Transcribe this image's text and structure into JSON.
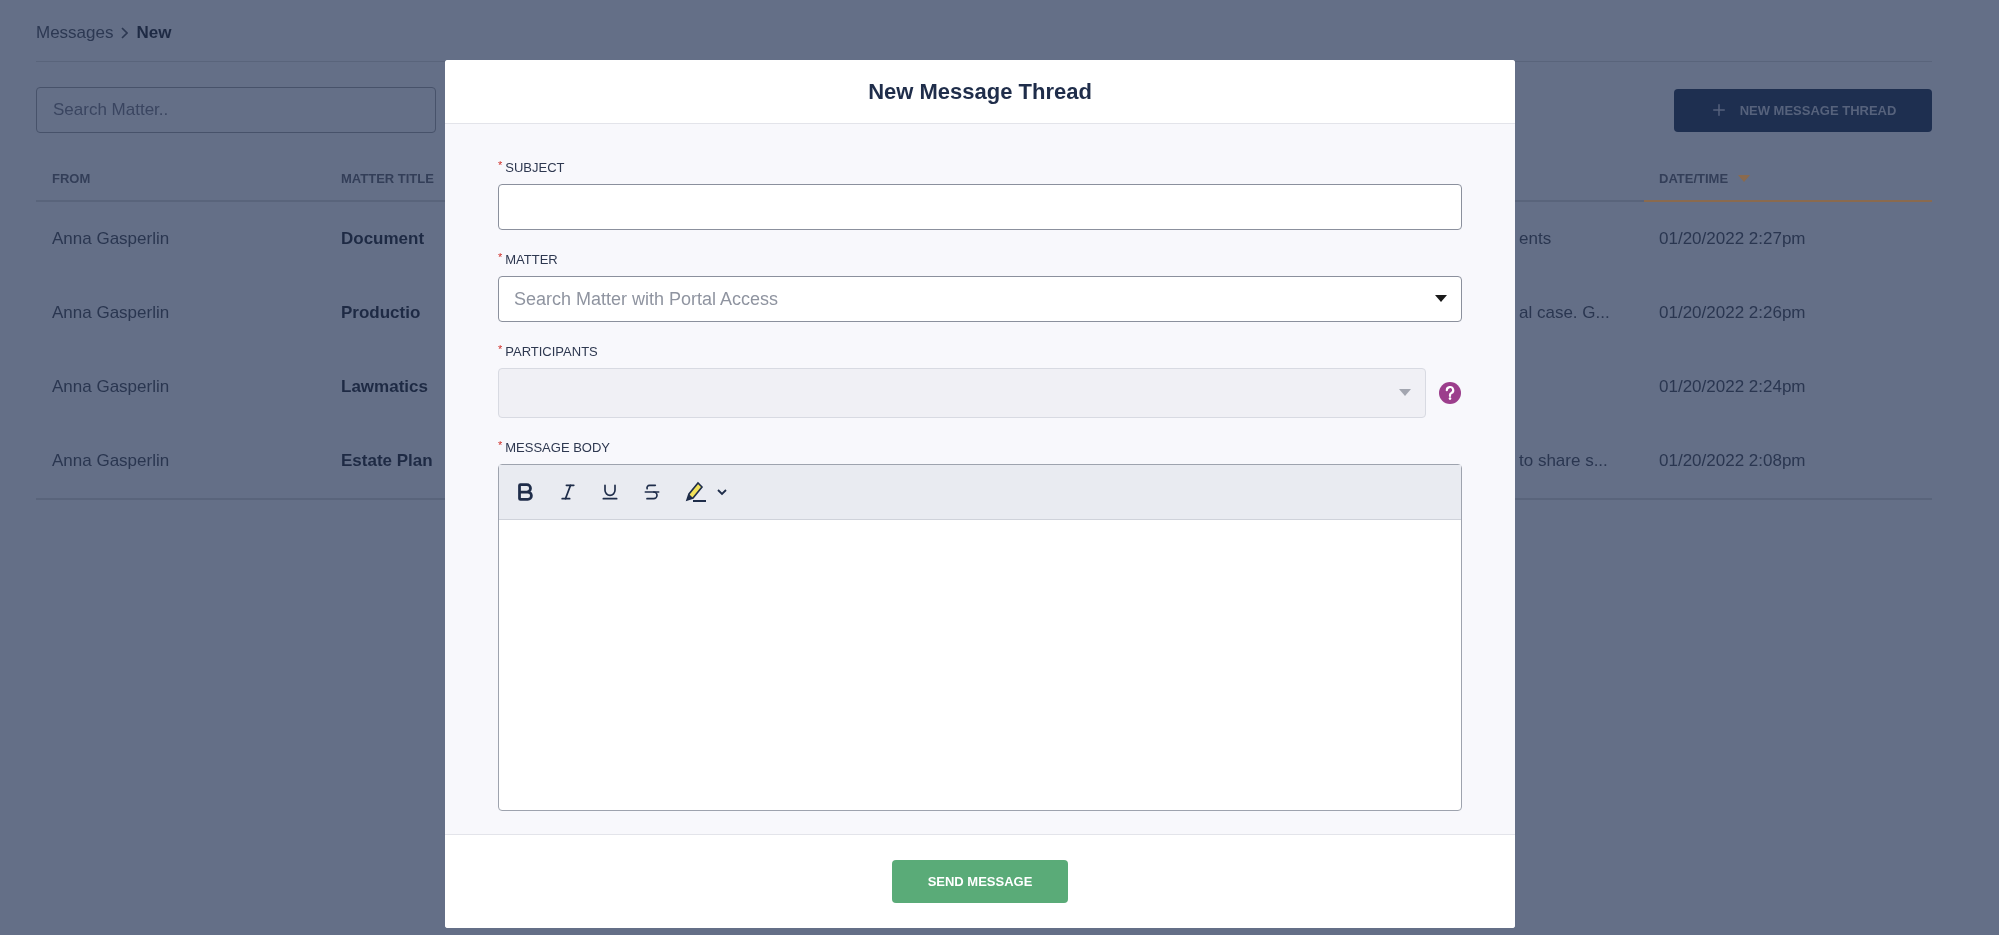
{
  "breadcrumb": {
    "items": [
      {
        "label": "Messages",
        "current": false
      },
      {
        "label": "New",
        "current": true
      }
    ]
  },
  "search": {
    "placeholder": "Search Matter.."
  },
  "new_thread_button": {
    "label": "NEW MESSAGE THREAD"
  },
  "table": {
    "columns": [
      {
        "label": "FROM",
        "sorted": false
      },
      {
        "label": "MATTER TITLE",
        "sorted": false
      },
      {
        "label": "DATE/TIME",
        "sorted": true
      }
    ],
    "rows": [
      {
        "from": "Anna Gasperlin",
        "matter_title": "Document",
        "column_3": "ents",
        "date_time": "01/20/2022 2:27pm"
      },
      {
        "from": "Anna Gasperlin",
        "matter_title": "Productio",
        "column_3": "al case. G...",
        "date_time": "01/20/2022 2:26pm"
      },
      {
        "from": "Anna Gasperlin",
        "matter_title": "Lawmatics",
        "date_time": "01/20/2022 2:24pm"
      },
      {
        "from": "Anna Gasperlin",
        "matter_title": "Estate Plan",
        "column_3": "to share s...",
        "date_time": "01/20/2022 2:08pm"
      }
    ]
  },
  "modal": {
    "title": "New Message Thread",
    "fields": [
      {
        "kind": "text",
        "label": "SUBJECT",
        "required_mark": "*"
      },
      {
        "kind": "select",
        "label": "MATTER",
        "required_mark": "*",
        "placeholder": "Search Matter with Portal Access",
        "disabled": false
      },
      {
        "kind": "select",
        "label": "PARTICIPANTS",
        "required_mark": "*",
        "disabled": true,
        "help": true
      },
      {
        "kind": "editor",
        "label": "MESSAGE BODY",
        "required_mark": "*"
      }
    ],
    "send_button": {
      "label": "SEND MESSAGE"
    }
  }
}
